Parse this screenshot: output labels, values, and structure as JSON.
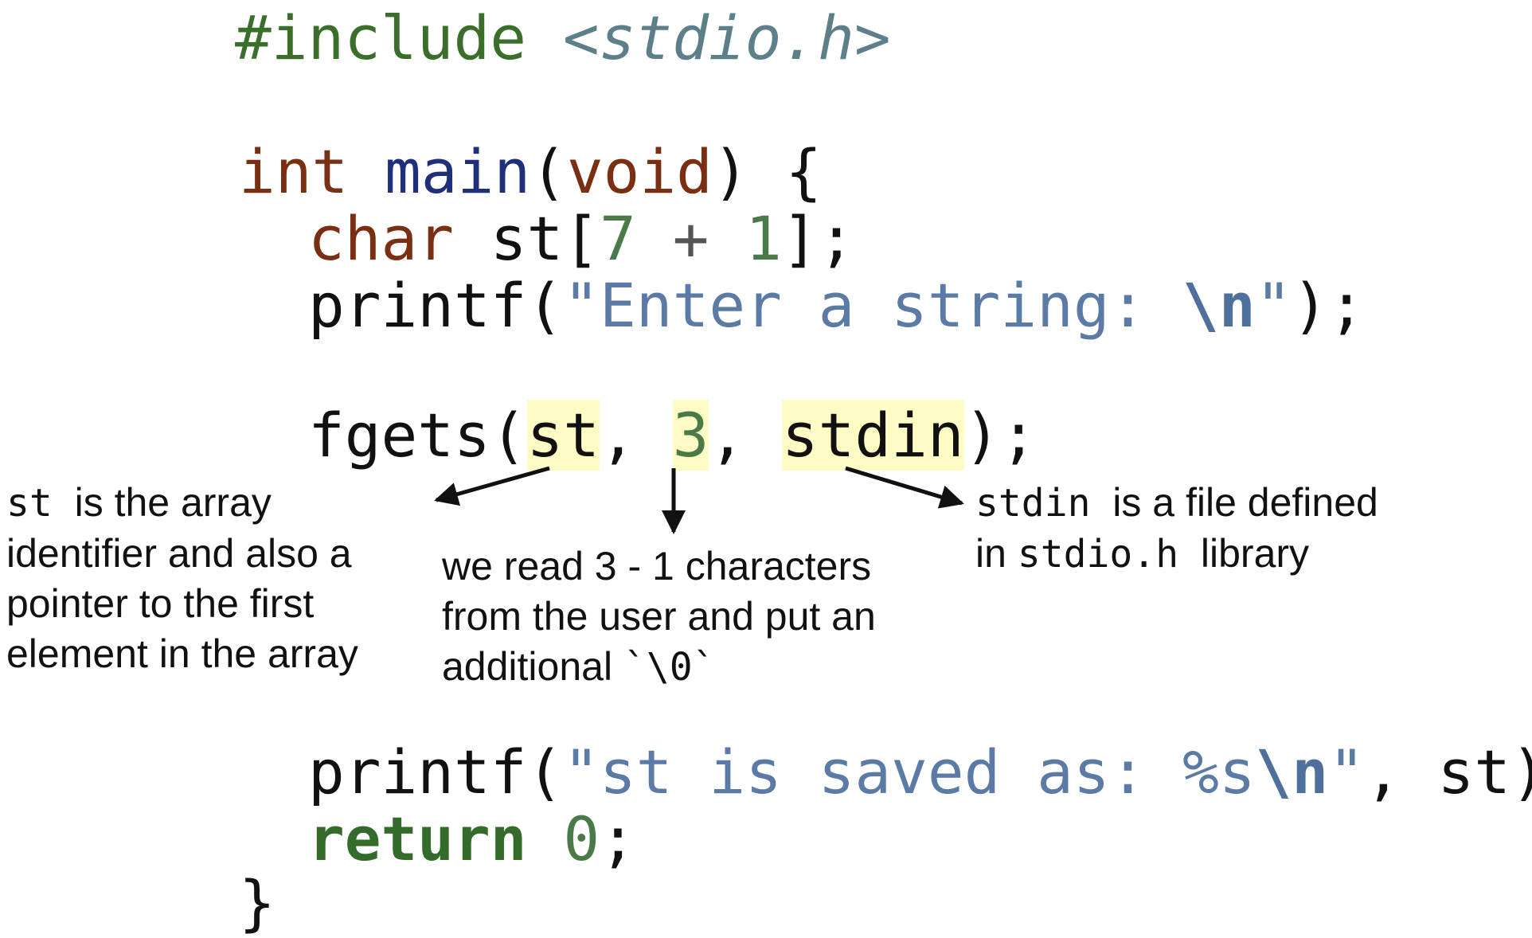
{
  "code": {
    "include": {
      "directive": "#include",
      "header": "<stdio.h>"
    },
    "main_sig": {
      "ret_type": "int",
      "name": "main",
      "open_paren": "(",
      "param": "void",
      "close": ") {"
    },
    "decl": {
      "type": "char",
      "name": " st[",
      "n1": "7",
      "plus": " + ",
      "n2": "1",
      "end": "];"
    },
    "printf1": {
      "fn": "printf(",
      "str_open": "\"Enter a string: ",
      "esc": "\\n",
      "str_close": "\"",
      "end": ");"
    },
    "fgets": {
      "fn": "fgets(",
      "arg1": "st",
      "comma1": ", ",
      "arg2": "3",
      "comma2": ", ",
      "arg3": "stdin",
      "end": ");"
    },
    "printf2": {
      "fn": "printf(",
      "str_open": "\"st is saved as: %s",
      "esc": "\\n",
      "str_close": "\"",
      "rest": ", st);"
    },
    "ret": {
      "kw": "return",
      "sp": " ",
      "val": "0",
      "end": ";"
    },
    "close": "}"
  },
  "annotations": {
    "st_note": {
      "code": "st",
      "line1": "  is the array",
      "line2": "identifier and also a",
      "line3": "pointer to the first",
      "line4": "element in the array"
    },
    "three_note": {
      "line1": "we read 3 - 1 characters",
      "line2": "from the user and put an",
      "line3": "additional ",
      "code": "`\\0`"
    },
    "stdin_note": {
      "code1": "stdin",
      "line1": "  is a file defined",
      "line2a": "in ",
      "code2": "stdio.h",
      "line2b": "  library"
    }
  },
  "colors": {
    "preprocessor": "#3b6e2a",
    "keyword": "#7a2e12",
    "function": "#1f2f7a",
    "number": "#4a7a48",
    "string": "#5c7aa6",
    "highlight": "#fdfcc4"
  }
}
